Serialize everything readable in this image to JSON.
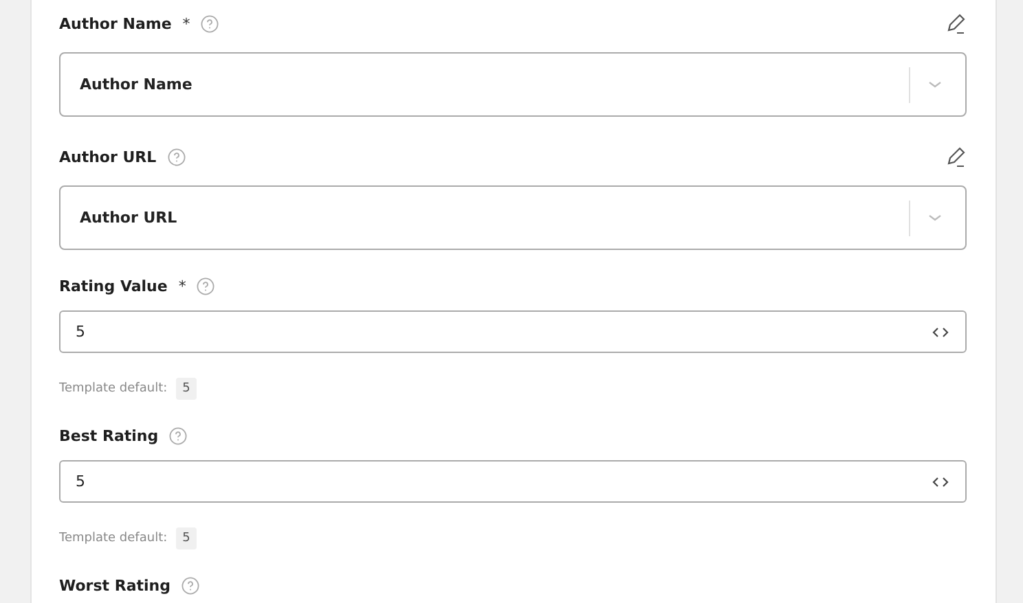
{
  "fields": [
    {
      "kind": "select",
      "label": "Author Name",
      "required_mark": "*",
      "value": "Author Name"
    },
    {
      "kind": "select",
      "label": "Author URL",
      "value": "Author URL"
    },
    {
      "kind": "input",
      "label": "Rating Value",
      "required_mark": "*",
      "value": "5",
      "default_label": "Template default:",
      "default_value": "5"
    },
    {
      "kind": "input",
      "label": "Best Rating",
      "value": "5",
      "default_label": "Template default:",
      "default_value": "5"
    },
    {
      "kind": "label",
      "label": "Worst Rating"
    }
  ]
}
